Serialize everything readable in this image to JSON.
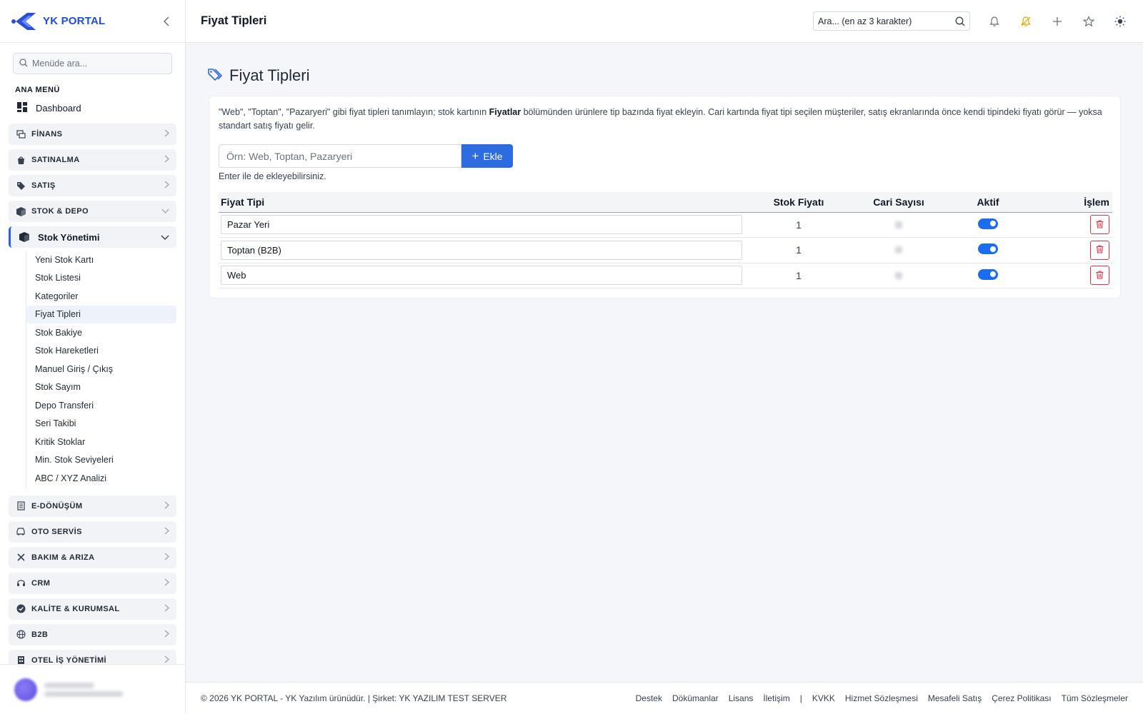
{
  "brand": {
    "name": "YK PORTAL"
  },
  "sidebar": {
    "search_placeholder": "Menüde ara...",
    "section_label": "ANA MENÜ",
    "dashboard_label": "Dashboard",
    "groups_top": [
      {
        "label": "FİNANS",
        "icon": "finance-icon"
      },
      {
        "label": "SATINALMA",
        "icon": "purchase-icon"
      },
      {
        "label": "SATIŞ",
        "icon": "tag-icon"
      },
      {
        "label": "STOK & DEPO",
        "icon": "box-icon"
      }
    ],
    "stock_management": {
      "label": "Stok Yönetimi",
      "items": [
        "Yeni Stok Kartı",
        "Stok Listesi",
        "Kategoriler",
        "Fiyat Tipleri",
        "Stok Bakiye",
        "Stok Hareketleri",
        "Manuel Giriş / Çıkış",
        "Stok Sayım",
        "Depo Transferi",
        "Seri Takibi",
        "Kritik Stoklar",
        "Min. Stok Seviyeleri",
        "ABC / XYZ Analizi"
      ],
      "active_item": "Fiyat Tipleri"
    },
    "groups_bottom": [
      {
        "label": "E-DÖNÜŞÜM",
        "icon": "document-icon"
      },
      {
        "label": "OTO SERVİS",
        "icon": "car-icon"
      },
      {
        "label": "BAKIM & ARIZA",
        "icon": "tools-icon"
      },
      {
        "label": "CRM",
        "icon": "headset-icon"
      },
      {
        "label": "KALİTE & KURUMSAL",
        "icon": "check-badge-icon"
      },
      {
        "label": "B2B",
        "icon": "globe-icon"
      },
      {
        "label": "OTEL İŞ YÖNETİMİ",
        "icon": "building-icon"
      }
    ]
  },
  "header": {
    "title": "Fiyat Tipleri",
    "search_placeholder": "Ara... (en az 3 karakter)"
  },
  "page": {
    "heading": "Fiyat Tipleri",
    "description_pre": "\"Web\", \"Toptan\", \"Pazaryeri\" gibi fiyat tipleri tanımlayın; stok kartının ",
    "description_bold": "Fiyatlar",
    "description_post": " bölümünden ürünlere tip bazında fiyat ekleyin. Cari kartında fiyat tipi seçilen müşteriler, satış ekranlarında önce kendi tipindeki fiyatı görür — yoksa standart satış fiyatı gelir.",
    "add_placeholder": "Örn: Web, Toptan, Pazaryeri",
    "add_button": "Ekle",
    "hint": "Enter ile de ekleyebilirsiniz.",
    "table": {
      "headers": {
        "name": "Fiyat Tipi",
        "stock_price": "Stok Fiyatı",
        "cari_count": "Cari Sayısı",
        "active": "Aktif",
        "action": "İşlem"
      },
      "rows": [
        {
          "name": "Pazar Yeri",
          "stock_price": "1",
          "active": true
        },
        {
          "name": "Toptan (B2B)",
          "stock_price": "1",
          "active": true
        },
        {
          "name": "Web",
          "stock_price": "1",
          "active": true
        }
      ]
    }
  },
  "footer": {
    "copyright": "© 2026 YK PORTAL - YK Yazılım ürünüdür. | Şirket: YK YAZILIM TEST SERVER",
    "links_left": [
      "Destek",
      "Dökümanlar",
      "Lisans",
      "İletişim"
    ],
    "links_right": [
      "KVKK",
      "Hizmet Sözleşmesi",
      "Mesafeli Satış",
      "Çerez Politikası",
      "Tüm Sözleşmeler"
    ]
  },
  "colors": {
    "primary": "#2c6be0",
    "danger": "#dc3545",
    "brand": "#1d4ed8"
  }
}
